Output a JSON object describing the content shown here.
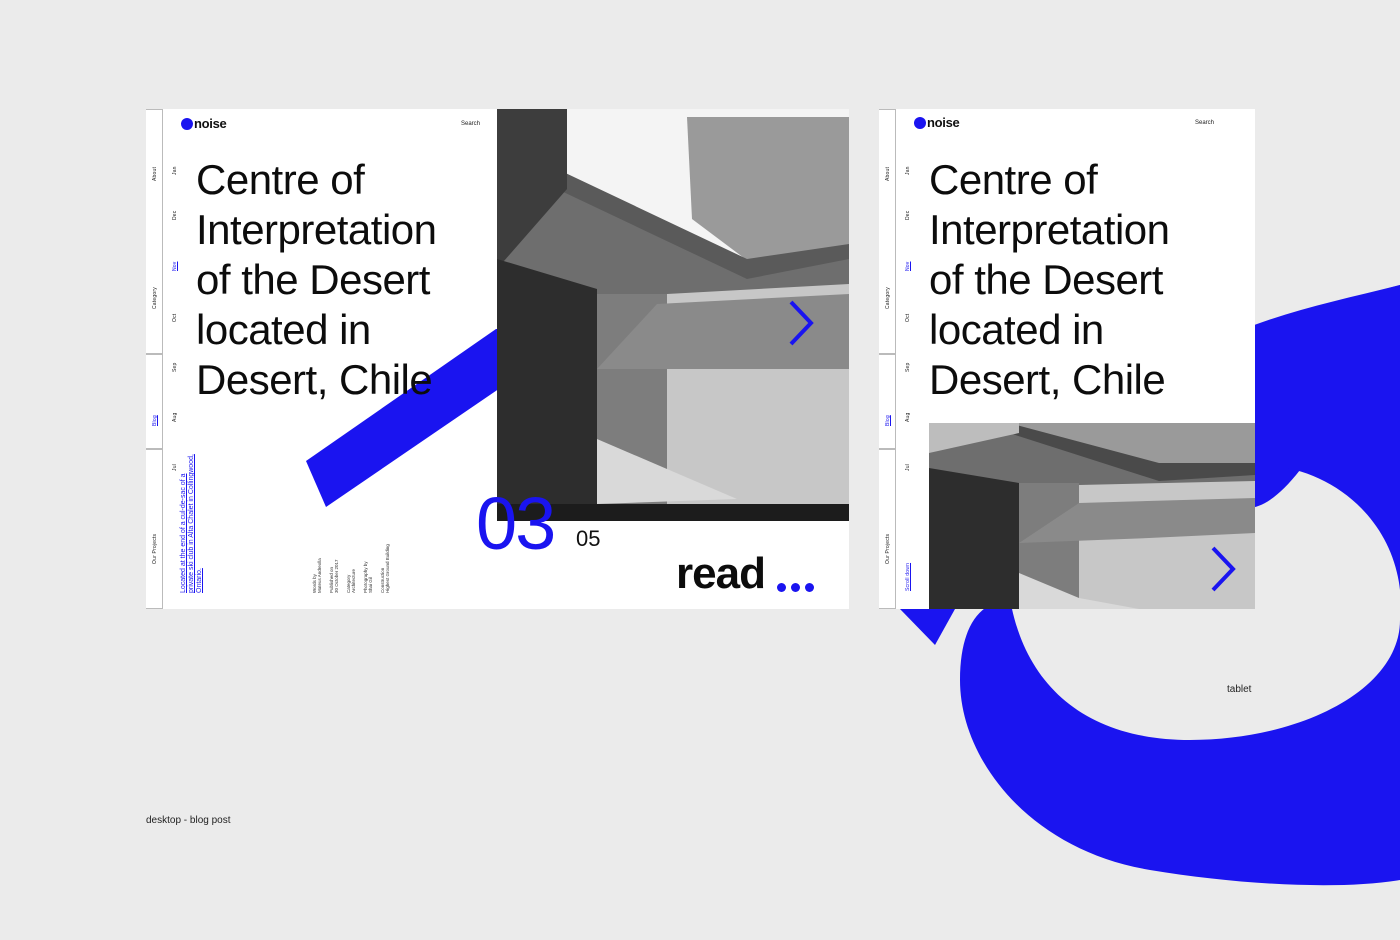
{
  "brand": {
    "logo_text": "noise",
    "accent_color": "#1a14f0"
  },
  "desktop": {
    "search_label": "Search",
    "nav": {
      "about": "About",
      "category": "Category",
      "blog": "Blog",
      "our_projects": "Our Projects"
    },
    "months": [
      "Jan",
      "Dec",
      "Nov",
      "Oct",
      "Sep",
      "Aug",
      "Jul"
    ],
    "active_month": "Nov",
    "headline": [
      "Centre of",
      "Interpretation",
      "of the Desert",
      "located in",
      "Desert, Chile"
    ],
    "slide_current": "03",
    "slide_total": "05",
    "read_label": "read",
    "excerpt": "Located at the end of a cul-de-sac of a private ski club in Alta Chalet in Collingwood, Ontario.",
    "meta": [
      {
        "label": "Words by",
        "value": "Mateus Andreolla"
      },
      {
        "label": "Published on",
        "value": "30 October 2017"
      },
      {
        "label": "Category",
        "value": "Architecture"
      },
      {
        "label": "Photography by",
        "value": "Shai Gil"
      },
      {
        "label": "Construction",
        "value": "Highest Ground Building"
      }
    ],
    "next_icon": "chevron-right-icon"
  },
  "tablet": {
    "search_label": "Search",
    "nav": {
      "about": "About",
      "category": "Category",
      "blog": "Blog",
      "our_projects": "Our Projects"
    },
    "months": [
      "Jan",
      "Dec",
      "Nov",
      "Oct",
      "Sep",
      "Aug",
      "Jul"
    ],
    "active_month": "Nov",
    "scroll_label": "Scroll down",
    "headline": [
      "Centre of",
      "Interpretation",
      "of the Desert",
      "located in",
      "Desert, Chile"
    ],
    "next_icon": "chevron-right-icon"
  },
  "captions": {
    "desktop": "desktop - blog post",
    "tablet": "tablet"
  }
}
